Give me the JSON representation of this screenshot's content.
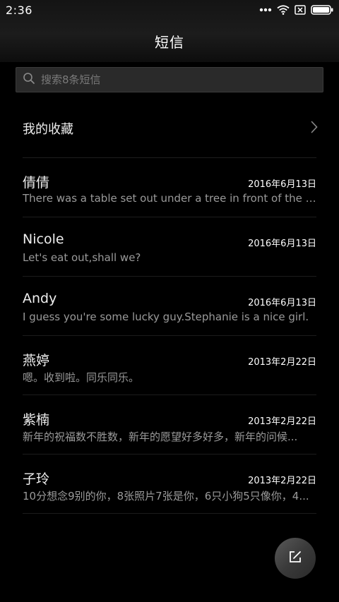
{
  "status_bar": {
    "time": "2:36",
    "icons": [
      "more-dots-icon",
      "wifi-icon",
      "sim-off-icon",
      "battery-icon"
    ]
  },
  "header": {
    "title": "短信"
  },
  "search": {
    "placeholder": "搜索8条短信",
    "value": ""
  },
  "favorites": {
    "label": "我的收藏"
  },
  "conversations": [
    {
      "name": "倩倩",
      "date": "2016年6月13日",
      "preview": "There was a table set out under a tree in front of the ho..."
    },
    {
      "name": "Nicole",
      "date": "2016年6月13日",
      "preview": "Let's eat out,shall we?"
    },
    {
      "name": "Andy",
      "date": "2016年6月13日",
      "preview": "I guess you're some lucky guy.Stephanie is a nice girl."
    },
    {
      "name": "燕婷",
      "date": "2013年2月22日",
      "preview": "嗯。收到啦。同乐同乐。"
    },
    {
      "name": "紫楠",
      "date": "2013年2月22日",
      "preview": "新年的祝福数不胜数，新年的愿望好多好多，新年的问候..."
    },
    {
      "name": "子玲",
      "date": "2013年2月22日",
      "preview": "10分想念9别的你，8张照片7张是你，6只小狗5只像你，4..."
    }
  ],
  "fab": {
    "icon": "compose-icon"
  },
  "colors": {
    "background": "#000000",
    "text_primary": "#eeeeee",
    "text_secondary": "#9a9a9a",
    "search_bg": "#2a2a2a"
  }
}
